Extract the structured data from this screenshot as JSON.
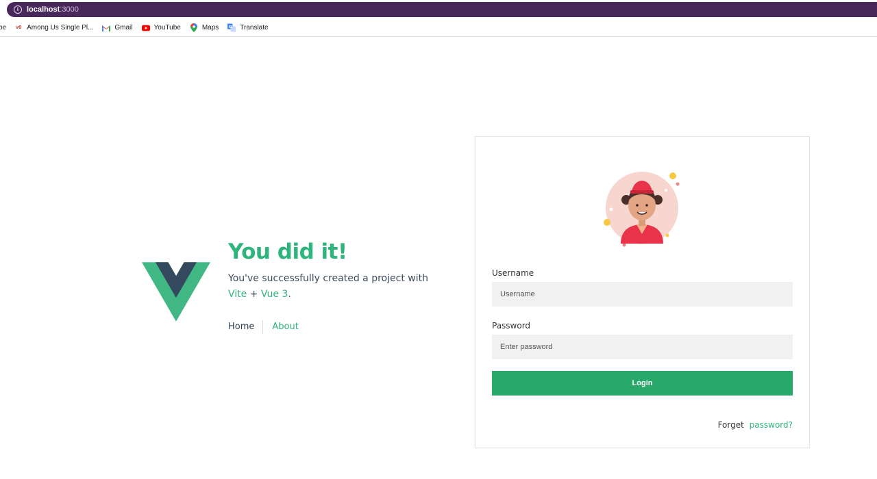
{
  "browser": {
    "url_host": "localhost",
    "url_port": ":3000",
    "bookmarks": [
      {
        "label": "be",
        "icon": "truncated"
      },
      {
        "label": "Among Us Single Pl...",
        "icon": "among-us-icon"
      },
      {
        "label": "Gmail",
        "icon": "gmail-icon"
      },
      {
        "label": "YouTube",
        "icon": "youtube-icon"
      },
      {
        "label": "Maps",
        "icon": "maps-icon"
      },
      {
        "label": "Translate",
        "icon": "translate-icon"
      }
    ]
  },
  "hero": {
    "title": "You did it!",
    "desc_prefix": "You've successfully created a project with",
    "vite": "Vite",
    "plus": "+",
    "vue": "Vue 3",
    "period": ".",
    "nav_home": "Home",
    "nav_about": "About"
  },
  "login": {
    "username_label": "Username",
    "username_placeholder": "Username",
    "password_label": "Password",
    "password_placeholder": "Enter password",
    "login_button": "Login",
    "forget_text": "Forget",
    "forget_link": "password?"
  },
  "colors": {
    "vue_green": "#41b883",
    "vue_dark": "#34495e",
    "accent": "#2fb47c",
    "button": "#28a86b",
    "urlbar": "#48285a"
  }
}
